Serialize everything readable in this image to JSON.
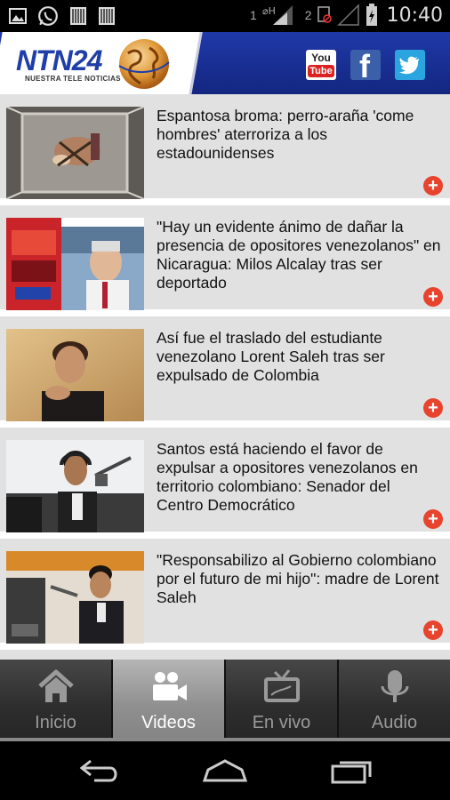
{
  "status_bar": {
    "sim1_label": "1",
    "sim2_label": "2",
    "time": "10:40"
  },
  "header": {
    "logo_title": "NTN24",
    "logo_subtitle": "NUESTRA TELE NOTICIAS",
    "social": {
      "youtube_top": "You",
      "youtube_bottom": "Tube",
      "facebook": "f"
    }
  },
  "news": [
    {
      "headline": "Espantosa broma: perro-araña 'come hombres' aterroriza a los estadounidenses",
      "thumbnail": "elevator-prank-thumbnail"
    },
    {
      "headline": " \"Hay un evidente ánimo de dañar la presencia de opositores venezolanos\" en Nicaragua: Milos Alcalay tras ser deportado",
      "thumbnail": "interview-broadcast-thumbnail"
    },
    {
      "headline": "Así fue el traslado del estudiante venezolano Lorent Saleh tras ser expulsado de Colombia",
      "thumbnail": "student-portrait-thumbnail"
    },
    {
      "headline": "Santos está haciendo el favor de expulsar a opositores venezolanos en territorio colombiano: Senador del Centro Democrático",
      "thumbnail": "radio-studio-thumbnail"
    },
    {
      "headline": "\"Responsabilizo al Gobierno colombiano por el futuro de mi hijo\": madre de Lorent Saleh",
      "thumbnail": "radio-booth-thumbnail"
    }
  ],
  "tabs": [
    {
      "label": "Inicio",
      "icon": "home-icon",
      "active": false
    },
    {
      "label": "Videos",
      "icon": "video-camera-icon",
      "active": true
    },
    {
      "label": "En vivo",
      "icon": "tv-icon",
      "active": false
    },
    {
      "label": "Audio",
      "icon": "microphone-icon",
      "active": false
    }
  ],
  "colors": {
    "header_blue": "#1f39a8",
    "accent_red": "#e8432d",
    "item_background": "#e1e1e1"
  }
}
